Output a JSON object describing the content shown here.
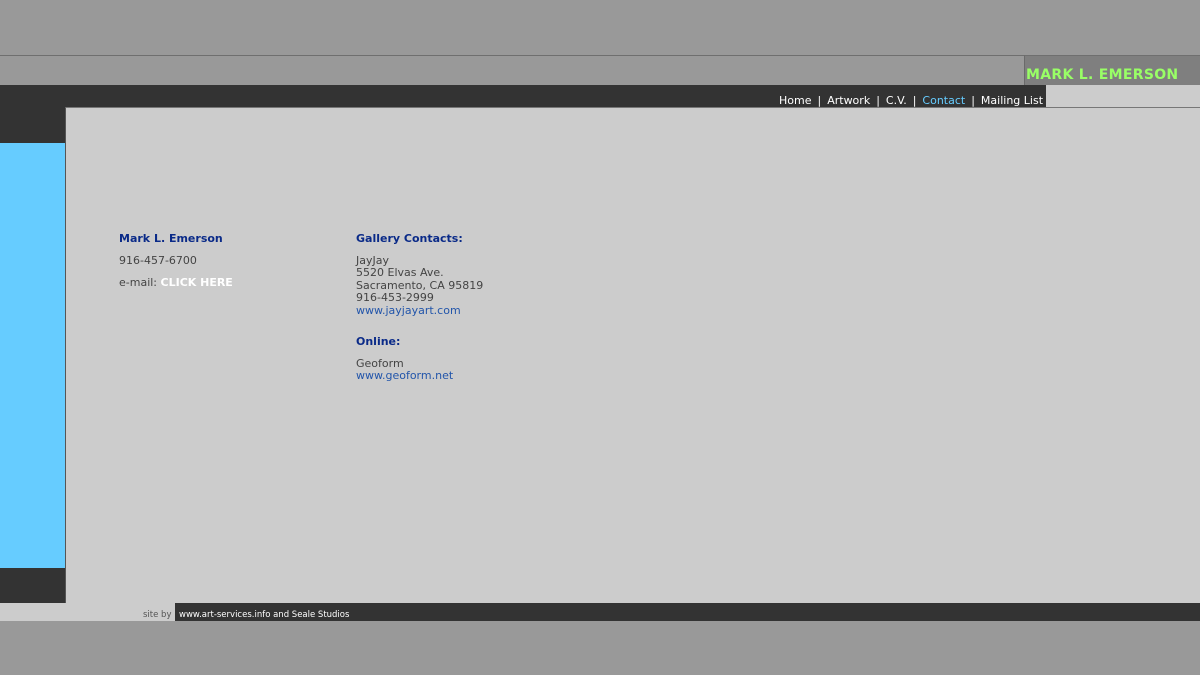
{
  "site": {
    "title": "MARK L. EMERSON"
  },
  "nav": {
    "items": [
      {
        "label": "Home"
      },
      {
        "label": "Artwork"
      },
      {
        "label": "C.V."
      },
      {
        "label": "Contact",
        "active": true
      },
      {
        "label": "Mailing List"
      }
    ],
    "separator": "|"
  },
  "contact": {
    "name": "Mark L. Emerson",
    "phone": "916-457-6700",
    "email_label": "e-mail:",
    "email_link": "CLICK HERE"
  },
  "gallery": {
    "heading": "Gallery Contacts:",
    "name": "JayJay",
    "address1": "5520 Elvas Ave.",
    "address2": "Sacramento, CA 95819",
    "phone": "916-453-2999",
    "url": "www.jayjayart.com"
  },
  "online": {
    "heading": "Online:",
    "name": "Geoform",
    "url": "www.geoform.net"
  },
  "footer": {
    "site_by": "site by",
    "credits": "www.art-services.info and Seale Studios"
  },
  "colors": {
    "background": "#999999",
    "dark": "#333333",
    "sidebar_blue": "#66ccff",
    "content": "#cccccc",
    "title_green": "#99ff66",
    "heading_blue": "#0a2a88",
    "active_nav": "#66ccff"
  }
}
